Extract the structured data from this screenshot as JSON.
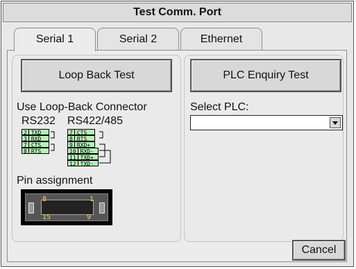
{
  "dialog": {
    "title": "Test Comm. Port"
  },
  "tabs": [
    {
      "label": "Serial 1",
      "active": true
    },
    {
      "label": "Serial 2",
      "active": false
    },
    {
      "label": "Ethernet",
      "active": false
    }
  ],
  "left": {
    "loopback_button": "Loop Back Test",
    "connector_label": "Use Loop-Back Connector",
    "rs232_label": "RS232",
    "rs422_label": "RS422/485",
    "rs232_pins": [
      {
        "num": "2",
        "sig": "TXD"
      },
      {
        "num": "3",
        "sig": "RXD"
      },
      {
        "num": "7",
        "sig": "CTS"
      },
      {
        "num": "8",
        "sig": "RTS"
      }
    ],
    "rs422_pins": [
      {
        "num": "7",
        "sig": "CTS"
      },
      {
        "num": "8",
        "sig": "RTS"
      },
      {
        "num": "9",
        "sig": "RXD+"
      },
      {
        "num": "10",
        "sig": "RXD-"
      },
      {
        "num": "11",
        "sig": "TXD+"
      },
      {
        "num": "12",
        "sig": "TXD-"
      }
    ],
    "pin_assignment_label": "Pin assignment",
    "connector_pins": {
      "top_left": "8",
      "top_right": "1",
      "bottom_left": "15",
      "bottom_right": "9"
    }
  },
  "right": {
    "plc_button": "PLC Enquiry Test",
    "select_label": "Select PLC:",
    "select_value": ""
  },
  "cancel_button": "Cancel"
}
